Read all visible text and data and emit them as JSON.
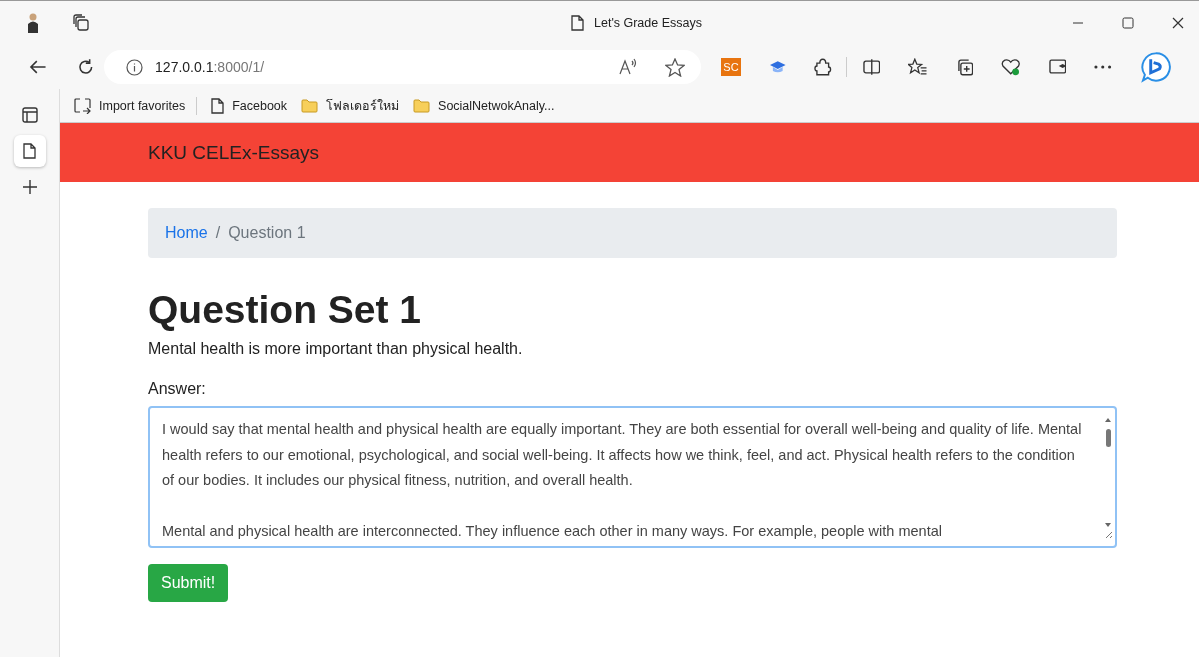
{
  "window": {
    "title": "Let's Grade Essays"
  },
  "address_bar": {
    "host": "127.0.0.1",
    "path": ":8000/1/"
  },
  "favorites": [
    {
      "kind": "import",
      "label": "Import favorites"
    },
    {
      "kind": "page",
      "label": "Facebook"
    },
    {
      "kind": "folder",
      "label": "โฟลเดอร์ใหม่"
    },
    {
      "kind": "folder",
      "label": "SocialNetwokAnaly..."
    }
  ],
  "extension_badge": "SC",
  "vertical_tabs": [
    {
      "kind": "page",
      "selected": true
    }
  ],
  "navbar": {
    "brand": "KKU CELEx-Essays"
  },
  "breadcrumb": [
    {
      "label": "Home",
      "link": true
    },
    {
      "label": "Question 1",
      "link": false
    }
  ],
  "breadcrumb_separator": "/",
  "heading": "Question Set 1",
  "question": "Mental health is more important than physical health.",
  "answer_label": "Answer:",
  "answer": "I would say that mental health and physical health are equally important. They are both essential for overall well-being and quality of life. Mental health refers to our emotional, psychological, and social well-being. It affects how we think, feel, and act. Physical health refers to the condition of our bodies. It includes our physical fitness, nutrition, and overall health.\n\nMental and physical health are interconnected. They influence each other in many ways. For example, people with mental",
  "submit": "Submit!"
}
